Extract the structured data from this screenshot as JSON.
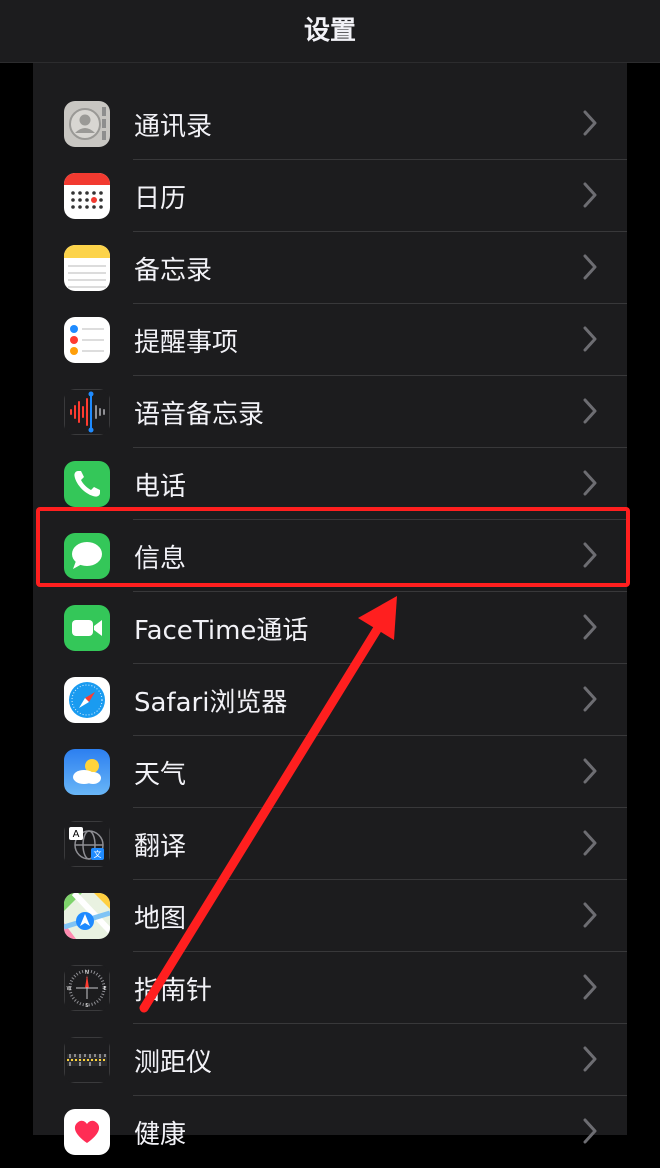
{
  "header": {
    "title": "设置"
  },
  "rows": [
    {
      "label": "通讯录",
      "icon": "contacts-icon"
    },
    {
      "label": "日历",
      "icon": "calendar-icon"
    },
    {
      "label": "备忘录",
      "icon": "notes-icon"
    },
    {
      "label": "提醒事项",
      "icon": "reminders-icon"
    },
    {
      "label": "语音备忘录",
      "icon": "voice-memos-icon"
    },
    {
      "label": "电话",
      "icon": "phone-icon"
    },
    {
      "label": "信息",
      "icon": "messages-icon"
    },
    {
      "label": "FaceTime通话",
      "icon": "facetime-icon"
    },
    {
      "label": "Safari浏览器",
      "icon": "safari-icon"
    },
    {
      "label": "天气",
      "icon": "weather-icon"
    },
    {
      "label": "翻译",
      "icon": "translate-icon"
    },
    {
      "label": "地图",
      "icon": "maps-icon"
    },
    {
      "label": "指南针",
      "icon": "compass-icon"
    },
    {
      "label": "测距仪",
      "icon": "measure-icon"
    },
    {
      "label": "健康",
      "icon": "health-icon"
    }
  ],
  "colors": {
    "highlight": "#ff1f1f",
    "background": "#1c1c1e"
  }
}
